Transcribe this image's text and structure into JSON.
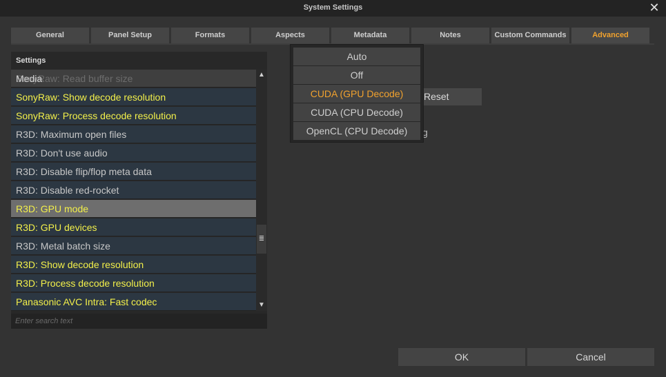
{
  "window": {
    "title": "System Settings"
  },
  "tabs": [
    {
      "label": "General"
    },
    {
      "label": "Panel Setup"
    },
    {
      "label": "Formats"
    },
    {
      "label": "Aspects"
    },
    {
      "label": "Metadata"
    },
    {
      "label": "Notes"
    },
    {
      "label": "Custom Commands"
    },
    {
      "label": "Advanced"
    }
  ],
  "settings": {
    "header": "Settings",
    "section_label": "Media",
    "partial_row": "SonyRaw: Read buffer size",
    "rows": [
      {
        "label": "SonyRaw: Show decode resolution",
        "highlight": true
      },
      {
        "label": "SonyRaw: Process decode resolution",
        "highlight": true
      },
      {
        "label": "R3D: Maximum open files",
        "highlight": false
      },
      {
        "label": "R3D: Don't use audio",
        "highlight": false
      },
      {
        "label": "R3D: Disable flip/flop meta data",
        "highlight": false
      },
      {
        "label": "R3D: Disable red-rocket",
        "highlight": false
      },
      {
        "label": "R3D: GPU mode",
        "highlight": true
      },
      {
        "label": "R3D: GPU devices",
        "highlight": true
      },
      {
        "label": "R3D: Metal batch size",
        "highlight": false
      },
      {
        "label": "R3D: Show decode resolution",
        "highlight": true
      },
      {
        "label": "R3D: Process decode resolution",
        "highlight": true
      },
      {
        "label": "Panasonic AVC Intra: Fast codec",
        "highlight": true
      }
    ],
    "search_placeholder": "Enter search text"
  },
  "detail": {
    "reset_label": "Reset",
    "partial_text": "g"
  },
  "dropdown": {
    "options": [
      {
        "label": "Auto"
      },
      {
        "label": "Off"
      },
      {
        "label": "CUDA (GPU Decode)"
      },
      {
        "label": "CUDA (CPU Decode)"
      },
      {
        "label": "OpenCL (CPU Decode)"
      }
    ],
    "selected": "CUDA (GPU Decode)"
  },
  "footer": {
    "ok_label": "OK",
    "cancel_label": "Cancel"
  },
  "colors": {
    "accent": "#f1a22e",
    "highlight_text": "#f3f04a",
    "row_bg": "#2c3742"
  },
  "icons": {
    "close": "close-icon",
    "scroll_up": "triangle-up-icon",
    "scroll_down": "triangle-down-icon",
    "grip": "grip-icon"
  }
}
